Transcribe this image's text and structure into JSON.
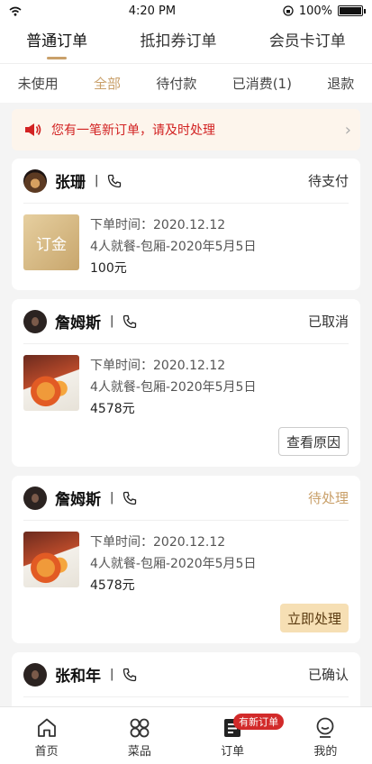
{
  "status_bar": {
    "time": "4:20 PM",
    "battery": "100%"
  },
  "top_tabs": [
    {
      "label": "普通订单",
      "active": true
    },
    {
      "label": "抵扣券订单",
      "active": false
    },
    {
      "label": "会员卡订单",
      "active": false
    }
  ],
  "sub_tabs": [
    {
      "label": "未使用"
    },
    {
      "label": "全部",
      "active": true
    },
    {
      "label": "待付款"
    },
    {
      "label": "已消费(1)"
    },
    {
      "label": "退款"
    }
  ],
  "notice": {
    "message": "您有一笔新订单，请及时处理",
    "icon": "speaker-icon"
  },
  "orders": [
    {
      "name": "张珊",
      "status": "待支付",
      "thumb_text": "订金",
      "order_time": "下单时间：2020.12.12",
      "detail": "4人就餐-包厢-2020年5月5日",
      "price": "100元"
    },
    {
      "name": "詹姆斯",
      "status": "已取消",
      "order_time": "下单时间：2020.12.12",
      "detail": "4人就餐-包厢-2020年5月5日",
      "price": "4578元",
      "action": "查看原因"
    },
    {
      "name": "詹姆斯",
      "status": "待处理",
      "order_time": "下单时间：2020.12.12",
      "detail": "4人就餐-包厢-2020年5月5日",
      "price": "4578元",
      "action": "立即处理"
    },
    {
      "name": "张和年",
      "status": "已确认"
    }
  ],
  "bottom_nav": [
    {
      "label": "首页",
      "icon": "home-icon"
    },
    {
      "label": "菜品",
      "icon": "dishes-icon"
    },
    {
      "label": "订单",
      "icon": "orders-icon",
      "badge": "有新订单",
      "active": true
    },
    {
      "label": "我的",
      "icon": "profile-icon"
    }
  ],
  "colors": {
    "accent": "#c9a06a",
    "alert": "#d22222"
  }
}
